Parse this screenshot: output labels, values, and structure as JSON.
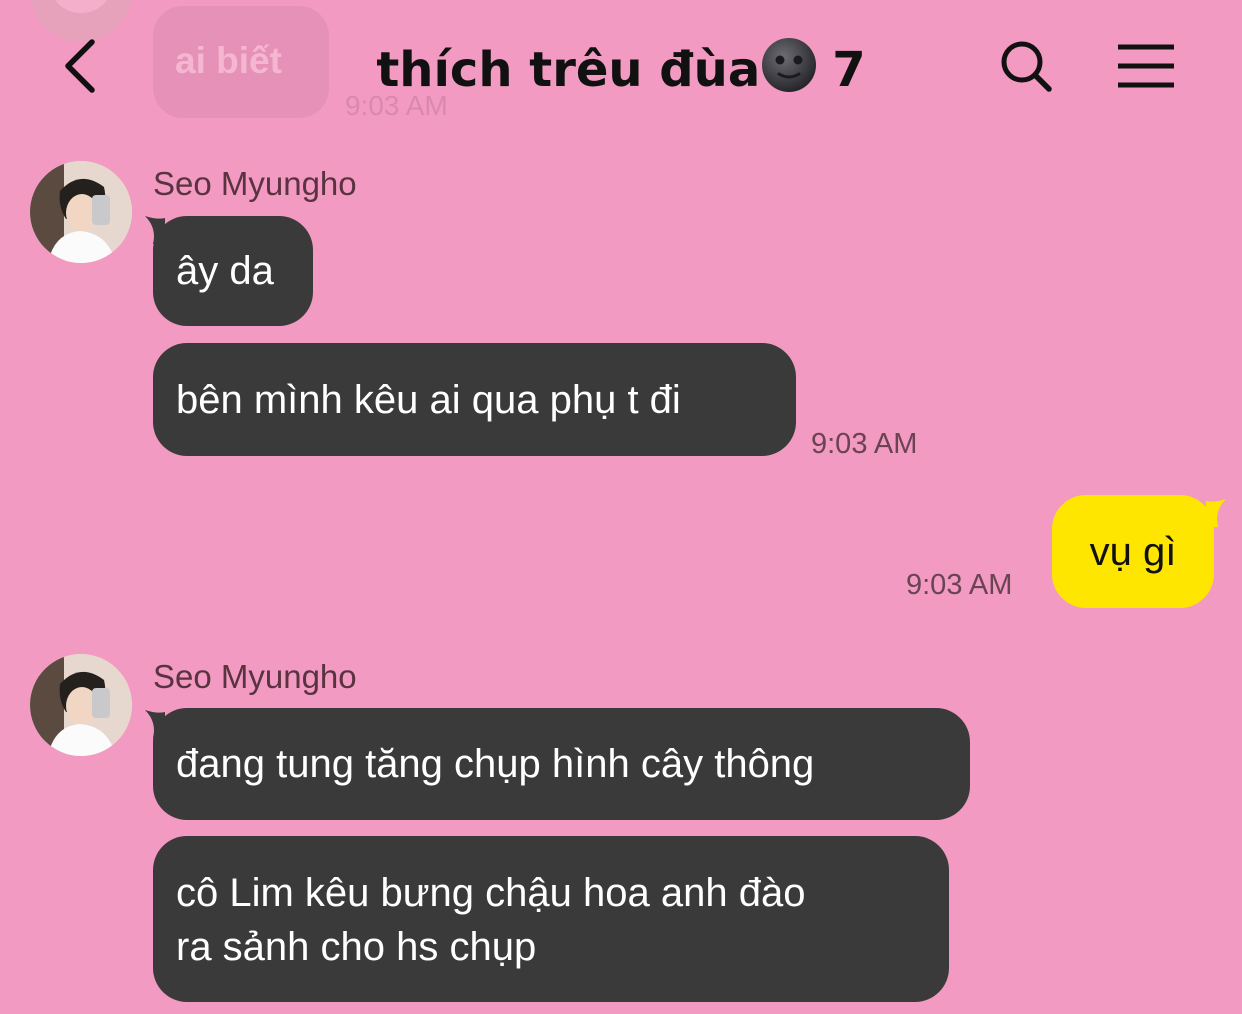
{
  "header": {
    "title": "thích trêu đùa",
    "title_emoji": "new-moon-face-icon",
    "member_count": "7",
    "back_icon": "chevron-left-icon",
    "search_icon": "search-icon",
    "menu_icon": "hamburger-menu-icon"
  },
  "colors": {
    "background": "#f29ac1",
    "incoming_bubble": "#3a3a3b",
    "outgoing_bubble": "#ffe600"
  },
  "messages": {
    "faded": {
      "text": "ai biết",
      "time": "9:03 AM"
    },
    "group1": {
      "sender": "Seo Myungho",
      "bubbles": [
        "ây da",
        "bên mình kêu ai qua phụ t đi"
      ],
      "time": "9:03 AM"
    },
    "outgoing": {
      "text": "vụ gì",
      "time": "9:03 AM"
    },
    "group2": {
      "sender": "Seo Myungho",
      "bubbles": [
        "đang tung tăng chụp hình cây thông",
        "cô Lim kêu bưng chậu hoa anh đào",
        "ra sảnh cho hs chụp"
      ]
    }
  }
}
